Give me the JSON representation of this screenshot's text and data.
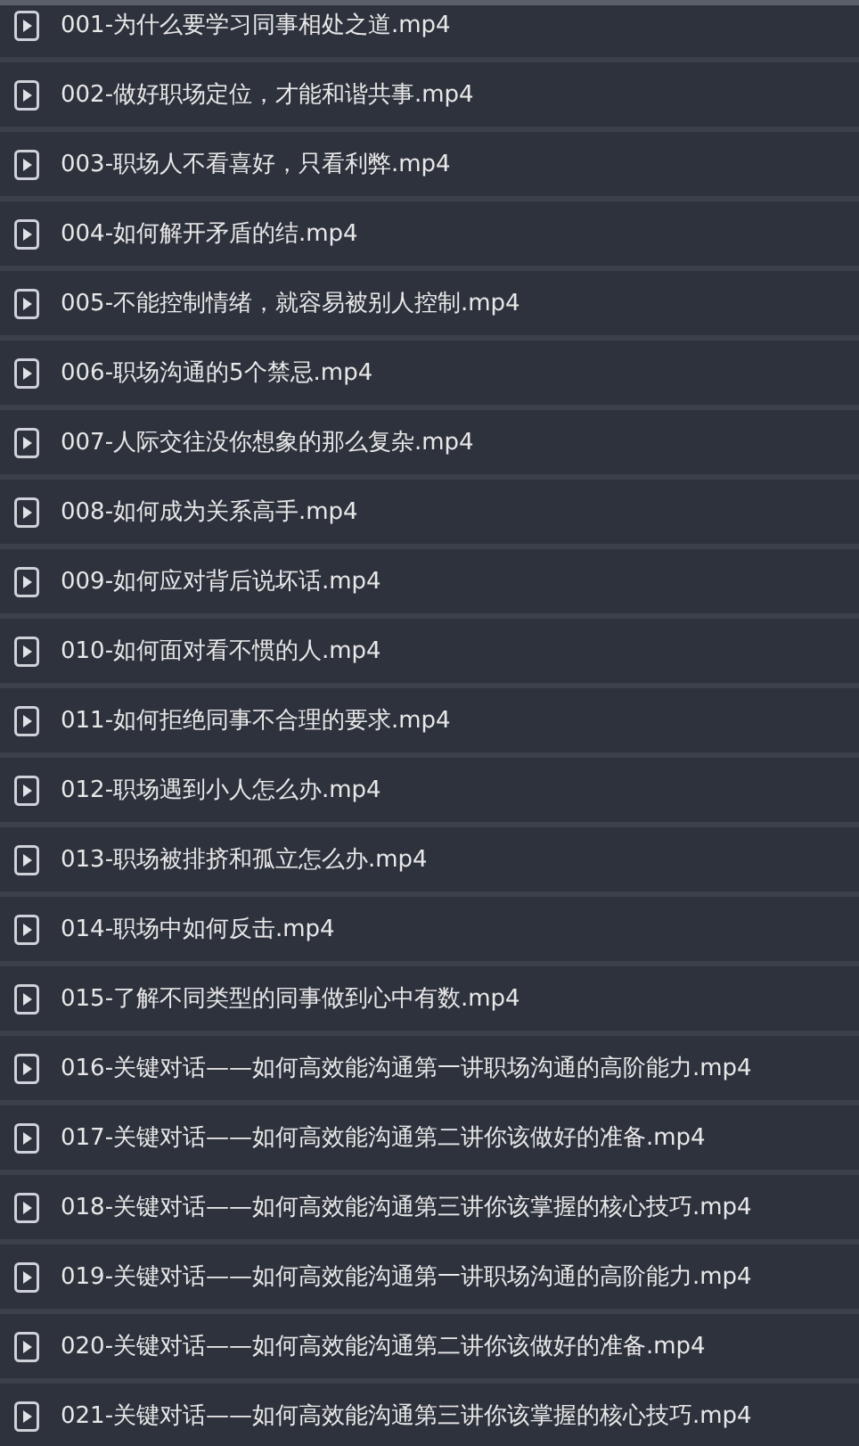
{
  "files": [
    {
      "name": "001-为什么要学习同事相处之道.mp4"
    },
    {
      "name": "002-做好职场定位，才能和谐共事.mp4"
    },
    {
      "name": "003-职场人不看喜好，只看利弊.mp4"
    },
    {
      "name": "004-如何解开矛盾的结.mp4"
    },
    {
      "name": "005-不能控制情绪，就容易被别人控制.mp4"
    },
    {
      "name": "006-职场沟通的5个禁忌.mp4"
    },
    {
      "name": "007-人际交往没你想象的那么复杂.mp4"
    },
    {
      "name": "008-如何成为关系高手.mp4"
    },
    {
      "name": "009-如何应对背后说坏话.mp4"
    },
    {
      "name": "010-如何面对看不惯的人.mp4"
    },
    {
      "name": "011-如何拒绝同事不合理的要求.mp4"
    },
    {
      "name": "012-职场遇到小人怎么办.mp4"
    },
    {
      "name": "013-职场被排挤和孤立怎么办.mp4"
    },
    {
      "name": "014-职场中如何反击.mp4"
    },
    {
      "name": "015-了解不同类型的同事做到心中有数.mp4"
    },
    {
      "name": "016-关键对话——如何高效能沟通第一讲职场沟通的高阶能力.mp4"
    },
    {
      "name": "017-关键对话——如何高效能沟通第二讲你该做好的准备.mp4"
    },
    {
      "name": "018-关键对话——如何高效能沟通第三讲你该掌握的核心技巧.mp4"
    },
    {
      "name": "019-关键对话——如何高效能沟通第一讲职场沟通的高阶能力.mp4"
    },
    {
      "name": "020-关键对话——如何高效能沟通第二讲你该做好的准备.mp4"
    },
    {
      "name": "021-关键对话——如何高效能沟通第三讲你该掌握的核心技巧.mp4"
    }
  ]
}
